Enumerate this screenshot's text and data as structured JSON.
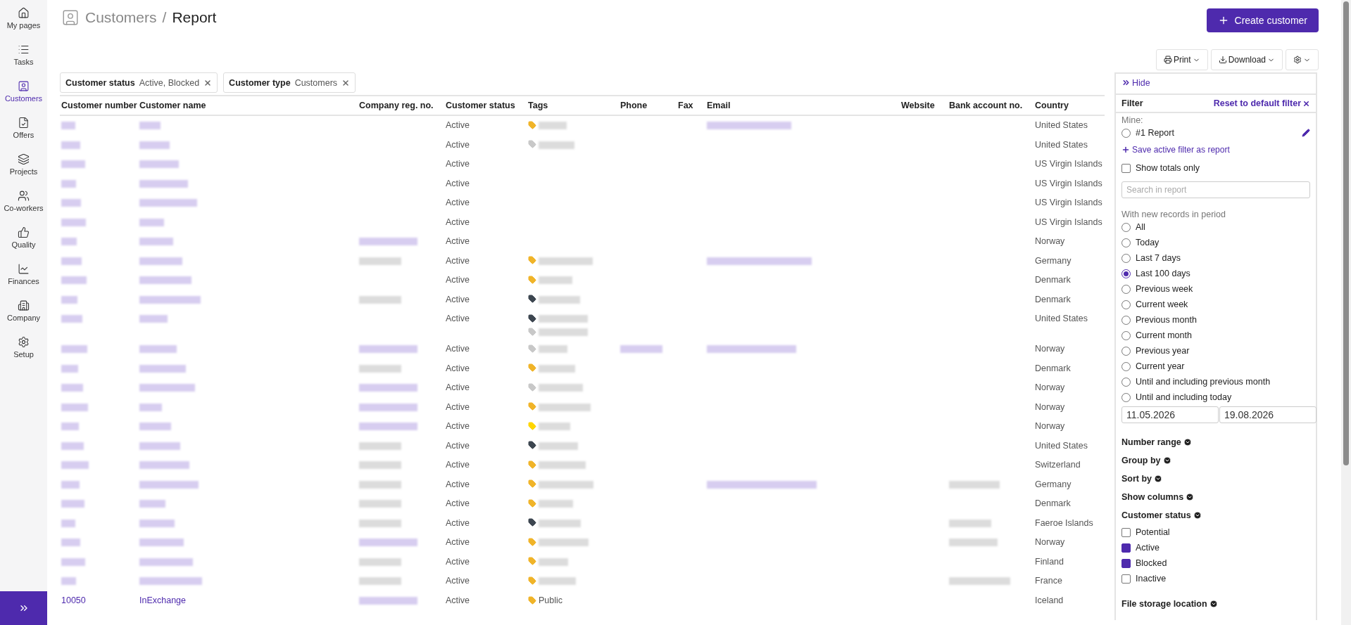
{
  "sidebar": {
    "items": [
      {
        "label": "My pages",
        "selected": false
      },
      {
        "label": "Tasks",
        "selected": false
      },
      {
        "label": "Customers",
        "selected": true
      },
      {
        "label": "Offers",
        "selected": false
      },
      {
        "label": "Projects",
        "selected": false
      },
      {
        "label": "Co-workers",
        "selected": false
      },
      {
        "label": "Quality",
        "selected": false
      },
      {
        "label": "Finances",
        "selected": false
      },
      {
        "label": "Company",
        "selected": false
      },
      {
        "label": "Setup",
        "selected": false
      }
    ]
  },
  "breadcrumb": {
    "parent": "Customers",
    "separator": "/",
    "current": "Report"
  },
  "create_button": "Create customer",
  "toolbar": {
    "print": "Print",
    "download": "Download"
  },
  "active_filters": [
    {
      "label": "Customer status",
      "value": "Active, Blocked"
    },
    {
      "label": "Customer type",
      "value": "Customers"
    }
  ],
  "table": {
    "columns": [
      "Customer number",
      "Customer name",
      "Company reg. no.",
      "Customer status",
      "Tags",
      "Phone",
      "Fax",
      "Email",
      "Website",
      "Bank account no.",
      "Country"
    ],
    "rows": [
      {
        "number": {
          "kind": "blurred"
        },
        "name": {
          "kind": "blurred"
        },
        "reg": null,
        "status": "Active",
        "tags": [
          {
            "color": "#f0b429",
            "label": {
              "kind": "blurred"
            }
          }
        ],
        "phone": null,
        "email": {
          "kind": "blurred"
        },
        "bank": null,
        "country": "United States"
      },
      {
        "number": {
          "kind": "blurred"
        },
        "name": {
          "kind": "blurred"
        },
        "reg": null,
        "status": "Active",
        "tags": [
          {
            "color": "#c8c8c8",
            "label": {
              "kind": "blurred"
            }
          }
        ],
        "phone": null,
        "email": null,
        "bank": null,
        "country": "United States"
      },
      {
        "number": {
          "kind": "blurred"
        },
        "name": {
          "kind": "blurred"
        },
        "reg": null,
        "status": "Active",
        "tags": [],
        "phone": null,
        "email": null,
        "bank": null,
        "country": "US Virgin Islands"
      },
      {
        "number": {
          "kind": "blurred"
        },
        "name": {
          "kind": "blurred"
        },
        "reg": null,
        "status": "Active",
        "tags": [],
        "phone": null,
        "email": null,
        "bank": null,
        "country": "US Virgin Islands"
      },
      {
        "number": {
          "kind": "blurred"
        },
        "name": {
          "kind": "blurred"
        },
        "reg": null,
        "status": "Active",
        "tags": [],
        "phone": null,
        "email": null,
        "bank": null,
        "country": "US Virgin Islands"
      },
      {
        "number": {
          "kind": "blurred"
        },
        "name": {
          "kind": "blurred"
        },
        "reg": null,
        "status": "Active",
        "tags": [],
        "phone": null,
        "email": null,
        "bank": null,
        "country": "US Virgin Islands"
      },
      {
        "number": {
          "kind": "blurred"
        },
        "name": {
          "kind": "blurred"
        },
        "reg": {
          "kind": "blurred",
          "link": true
        },
        "status": "Active",
        "tags": [],
        "phone": null,
        "email": null,
        "bank": null,
        "country": "Norway"
      },
      {
        "number": {
          "kind": "blurred"
        },
        "name": {
          "kind": "blurred"
        },
        "reg": {
          "kind": "blurred",
          "link": false
        },
        "status": "Active",
        "tags": [
          {
            "color": "#f0b429",
            "label": {
              "kind": "blurred"
            }
          }
        ],
        "phone": null,
        "email": {
          "kind": "blurred"
        },
        "bank": null,
        "country": "Germany"
      },
      {
        "number": {
          "kind": "blurred"
        },
        "name": {
          "kind": "blurred"
        },
        "reg": null,
        "status": "Active",
        "tags": [
          {
            "color": "#f0b429",
            "label": {
              "kind": "blurred"
            }
          }
        ],
        "phone": null,
        "email": null,
        "bank": null,
        "country": "Denmark"
      },
      {
        "number": {
          "kind": "blurred"
        },
        "name": {
          "kind": "blurred"
        },
        "reg": {
          "kind": "blurred",
          "link": false
        },
        "status": "Active",
        "tags": [
          {
            "color": "#3d4650",
            "label": {
              "kind": "blurred"
            }
          }
        ],
        "phone": null,
        "email": null,
        "bank": null,
        "country": "Denmark"
      },
      {
        "number": {
          "kind": "blurred"
        },
        "name": {
          "kind": "blurred"
        },
        "reg": null,
        "status": "Active",
        "tags": [
          {
            "color": "#3d4650",
            "label": {
              "kind": "blurred"
            }
          },
          {
            "color": "#c8c8c8",
            "label": {
              "kind": "blurred"
            }
          }
        ],
        "phone": null,
        "email": null,
        "bank": null,
        "country": "United States"
      },
      {
        "number": {
          "kind": "blurred"
        },
        "name": {
          "kind": "blurred"
        },
        "reg": {
          "kind": "blurred",
          "link": true
        },
        "status": "Active",
        "tags": [
          {
            "color": "#c8c8c8",
            "label": {
              "kind": "blurred"
            }
          }
        ],
        "phone": {
          "kind": "blurred"
        },
        "email": {
          "kind": "blurred"
        },
        "bank": null,
        "country": "Norway"
      },
      {
        "number": {
          "kind": "blurred"
        },
        "name": {
          "kind": "blurred"
        },
        "reg": {
          "kind": "blurred",
          "link": false
        },
        "status": "Active",
        "tags": [
          {
            "color": "#f0b429",
            "label": {
              "kind": "blurred"
            }
          }
        ],
        "phone": null,
        "email": null,
        "bank": null,
        "country": "Denmark"
      },
      {
        "number": {
          "kind": "blurred"
        },
        "name": {
          "kind": "blurred"
        },
        "reg": {
          "kind": "blurred",
          "link": true
        },
        "status": "Active",
        "tags": [
          {
            "color": "#c8c8c8",
            "label": {
              "kind": "blurred"
            }
          }
        ],
        "phone": null,
        "email": null,
        "bank": null,
        "country": "Norway"
      },
      {
        "number": {
          "kind": "blurred"
        },
        "name": {
          "kind": "blurred"
        },
        "reg": {
          "kind": "blurred",
          "link": true
        },
        "status": "Active",
        "tags": [
          {
            "color": "#f0b429",
            "label": {
              "kind": "blurred"
            }
          }
        ],
        "phone": null,
        "email": null,
        "bank": null,
        "country": "Norway"
      },
      {
        "number": {
          "kind": "blurred"
        },
        "name": {
          "kind": "blurred"
        },
        "reg": {
          "kind": "blurred",
          "link": true
        },
        "status": "Active",
        "tags": [
          {
            "color": "#ffd600",
            "label": {
              "kind": "blurred"
            }
          }
        ],
        "phone": null,
        "email": null,
        "bank": null,
        "country": "Norway"
      },
      {
        "number": {
          "kind": "blurred"
        },
        "name": {
          "kind": "blurred"
        },
        "reg": {
          "kind": "blurred",
          "link": false
        },
        "status": "Active",
        "tags": [
          {
            "color": "#3d4650",
            "label": {
              "kind": "blurred"
            }
          }
        ],
        "phone": null,
        "email": null,
        "bank": null,
        "country": "United States"
      },
      {
        "number": {
          "kind": "blurred"
        },
        "name": {
          "kind": "blurred"
        },
        "reg": {
          "kind": "blurred",
          "link": false
        },
        "status": "Active",
        "tags": [
          {
            "color": "#f0b429",
            "label": {
              "kind": "blurred"
            }
          }
        ],
        "phone": null,
        "email": null,
        "bank": null,
        "country": "Switzerland"
      },
      {
        "number": {
          "kind": "blurred"
        },
        "name": {
          "kind": "blurred"
        },
        "reg": {
          "kind": "blurred",
          "link": false
        },
        "status": "Active",
        "tags": [
          {
            "color": "#f0b429",
            "label": {
              "kind": "blurred"
            }
          }
        ],
        "phone": null,
        "email": {
          "kind": "blurred"
        },
        "bank": {
          "kind": "blurred"
        },
        "country": "Germany"
      },
      {
        "number": {
          "kind": "blurred"
        },
        "name": {
          "kind": "blurred"
        },
        "reg": {
          "kind": "blurred",
          "link": false
        },
        "status": "Active",
        "tags": [
          {
            "color": "#f0b429",
            "label": {
              "kind": "blurred"
            }
          }
        ],
        "phone": null,
        "email": null,
        "bank": null,
        "country": "Denmark"
      },
      {
        "number": {
          "kind": "blurred"
        },
        "name": {
          "kind": "blurred"
        },
        "reg": {
          "kind": "blurred",
          "link": false
        },
        "status": "Active",
        "tags": [
          {
            "color": "#3d4650",
            "label": {
              "kind": "blurred"
            }
          }
        ],
        "phone": null,
        "email": null,
        "bank": {
          "kind": "blurred"
        },
        "country": "Faeroe Islands"
      },
      {
        "number": {
          "kind": "blurred"
        },
        "name": {
          "kind": "blurred"
        },
        "reg": {
          "kind": "blurred",
          "link": true
        },
        "status": "Active",
        "tags": [
          {
            "color": "#f0b429",
            "label": {
              "kind": "blurred"
            }
          }
        ],
        "phone": null,
        "email": null,
        "bank": {
          "kind": "blurred"
        },
        "country": "Norway"
      },
      {
        "number": {
          "kind": "blurred"
        },
        "name": {
          "kind": "blurred"
        },
        "reg": {
          "kind": "blurred",
          "link": false
        },
        "status": "Active",
        "tags": [
          {
            "color": "#f0b429",
            "label": {
              "kind": "blurred"
            }
          }
        ],
        "phone": null,
        "email": null,
        "bank": null,
        "country": "Finland"
      },
      {
        "number": {
          "kind": "blurred"
        },
        "name": {
          "kind": "blurred"
        },
        "reg": {
          "kind": "blurred",
          "link": false
        },
        "status": "Active",
        "tags": [
          {
            "color": "#f0b429",
            "label": {
              "kind": "blurred"
            }
          }
        ],
        "phone": null,
        "email": null,
        "bank": {
          "kind": "blurred"
        },
        "country": "France"
      },
      {
        "number": "10050",
        "name": "InExchange",
        "reg": {
          "kind": "blurred",
          "link": true
        },
        "status": "Active",
        "tags": [
          {
            "color": "#f0b429",
            "label": "Public"
          }
        ],
        "phone": null,
        "email": null,
        "bank": null,
        "country": "Iceland"
      }
    ]
  },
  "filter_panel": {
    "hide": "Hide",
    "title": "Filter",
    "reset": "Reset to default filter",
    "mine_label": "Mine:",
    "reports": [
      {
        "label": "#1 Report",
        "selected": false
      }
    ],
    "save_link": "Save active filter as report",
    "show_totals": {
      "label": "Show totals only",
      "checked": false
    },
    "search": {
      "placeholder": "Search in report"
    },
    "period_label": "With new records in period",
    "periods": [
      {
        "label": "All",
        "selected": false
      },
      {
        "label": "Today",
        "selected": false
      },
      {
        "label": "Last 7 days",
        "selected": false
      },
      {
        "label": "Last 100 days",
        "selected": true
      },
      {
        "label": "Previous week",
        "selected": false
      },
      {
        "label": "Current week",
        "selected": false
      },
      {
        "label": "Previous month",
        "selected": false
      },
      {
        "label": "Current month",
        "selected": false
      },
      {
        "label": "Previous year",
        "selected": false
      },
      {
        "label": "Current year",
        "selected": false
      },
      {
        "label": "Until and including previous month",
        "selected": false
      },
      {
        "label": "Until and including today",
        "selected": false
      }
    ],
    "date_from": "11.05.2026",
    "date_to": "19.08.2026",
    "sections": [
      "Number range",
      "Group by",
      "Sort by",
      "Show columns"
    ],
    "status_section": "Customer status",
    "statuses": [
      {
        "label": "Potential",
        "checked": false
      },
      {
        "label": "Active",
        "checked": true
      },
      {
        "label": "Blocked",
        "checked": true
      },
      {
        "label": "Inactive",
        "checked": false
      }
    ],
    "file_section": "File storage location"
  }
}
